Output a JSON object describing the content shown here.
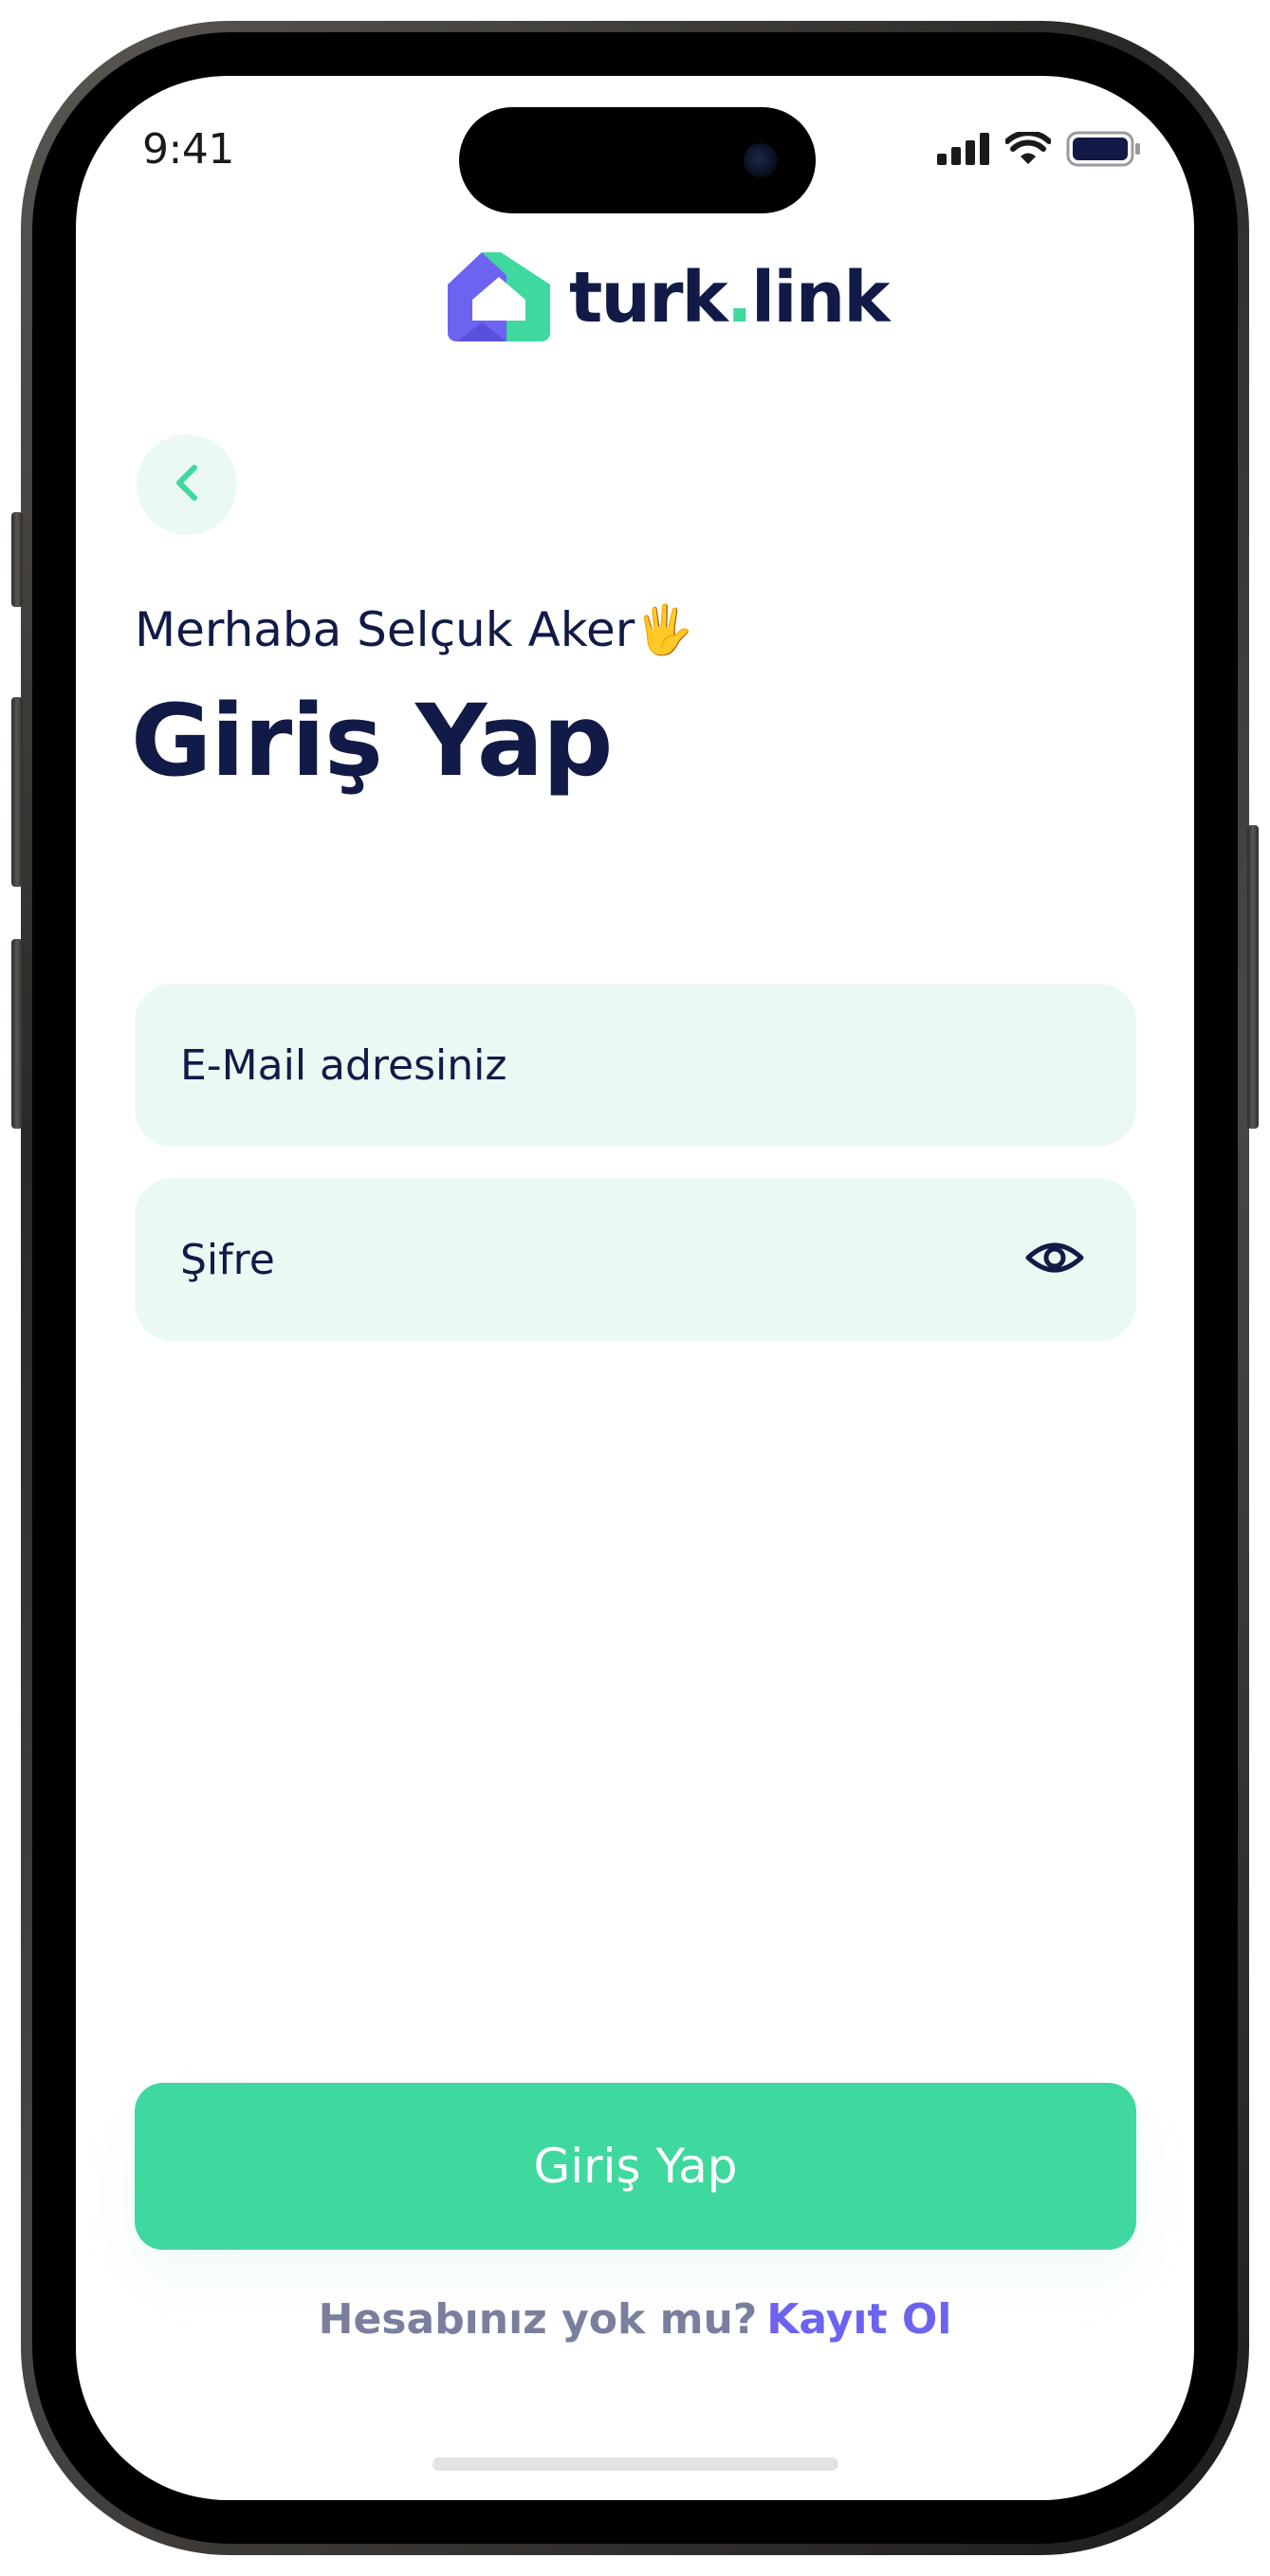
{
  "status_bar": {
    "time": "9:41",
    "icons": [
      "cellular-signal-icon",
      "wifi-icon",
      "battery-icon"
    ]
  },
  "brand": {
    "name_main": "turk",
    "name_dot": ".",
    "name_tail": "link",
    "logo_icon": "house-logo-icon",
    "colors": {
      "navy": "#121a47",
      "green": "#3fd89e",
      "purple": "#6c63f0",
      "field_bg": "#eaf9f3"
    }
  },
  "header": {
    "back_icon": "chevron-left-icon",
    "greeting": "Merhaba Selçuk Aker🖐",
    "title": "Giriş Yap"
  },
  "form": {
    "email": {
      "value": "",
      "placeholder": "E-Mail adresiniz"
    },
    "password": {
      "value": "",
      "placeholder": "Şifre",
      "toggle_icon": "eye-icon"
    }
  },
  "actions": {
    "submit_label": "Giriş Yap",
    "signup_question": "Hesabınız yok mu?",
    "signup_link": "Kayıt Ol"
  }
}
